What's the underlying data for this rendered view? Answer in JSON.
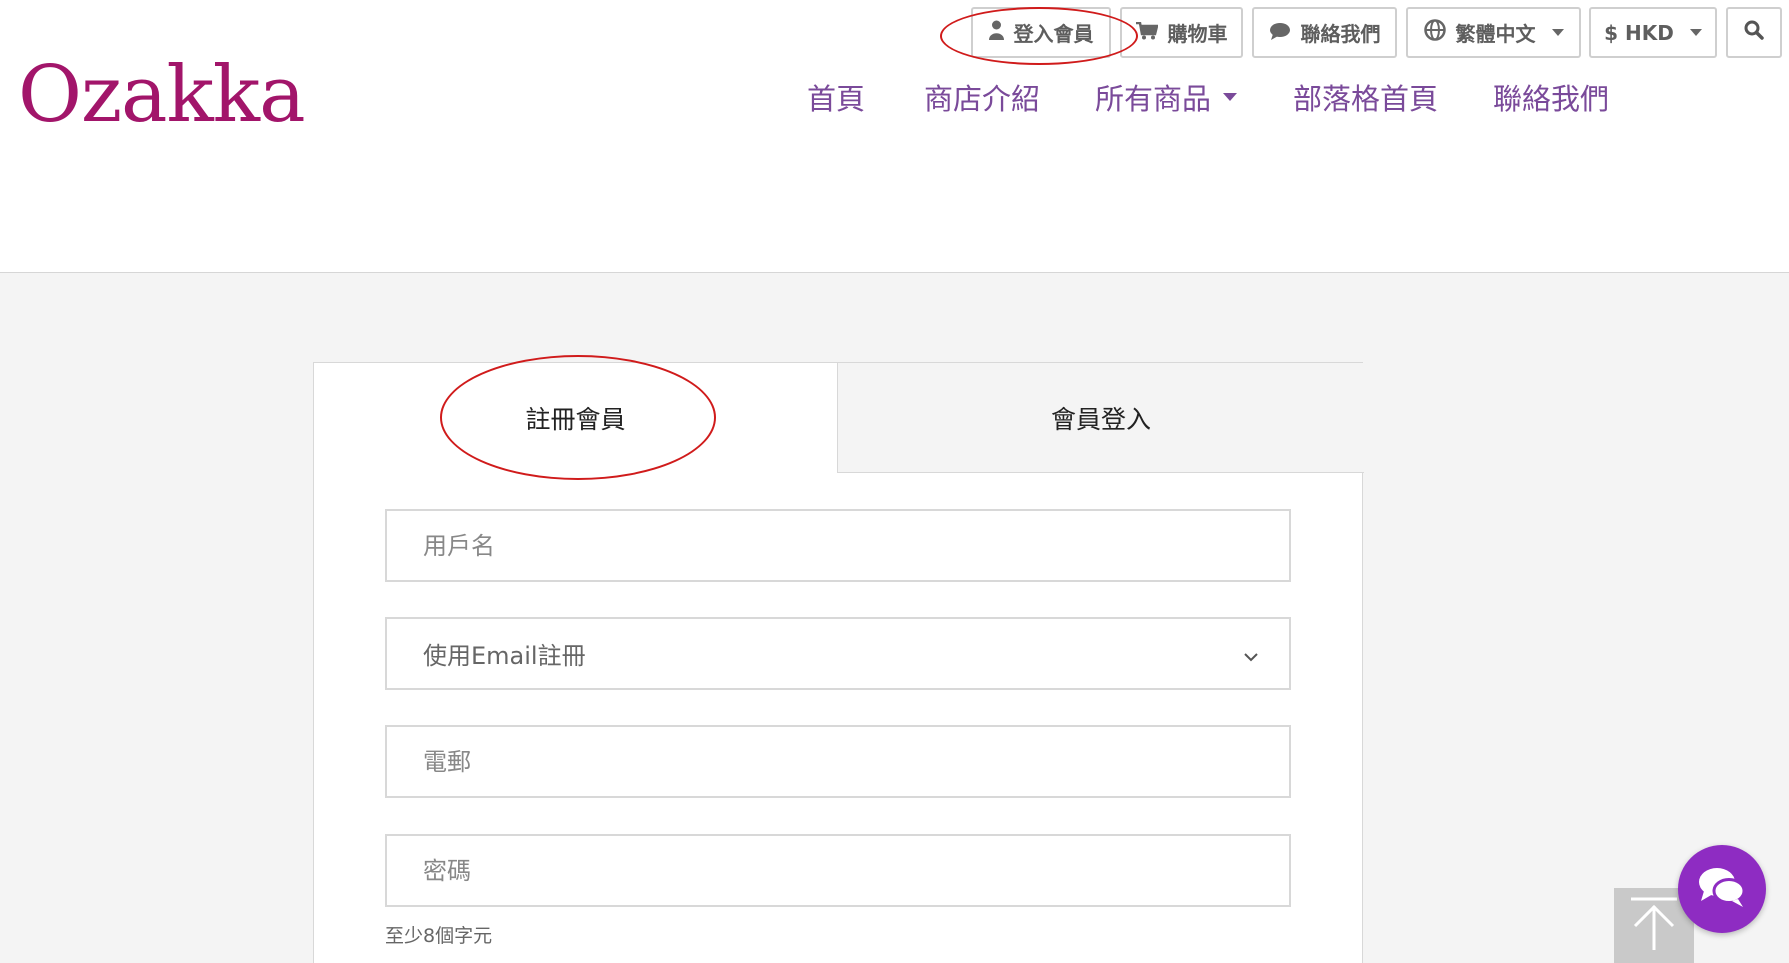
{
  "brand": {
    "logo_text": "Ozakka",
    "logo_color": "#a2156a"
  },
  "topbar": {
    "login_label": "登入會員",
    "cart_label": "購物車",
    "contact_label": "聯絡我們",
    "language_label": "繁體中文",
    "currency_label": "$ HKD",
    "icons": [
      "user-icon",
      "cart-icon",
      "chat-bubble-icon",
      "globe-icon",
      "search-icon"
    ]
  },
  "nav": {
    "items": [
      {
        "label": "首頁"
      },
      {
        "label": "商店介紹"
      },
      {
        "label": "所有商品",
        "has_dropdown": true
      },
      {
        "label": "部落格首頁"
      },
      {
        "label": "聯絡我們"
      }
    ],
    "color": "#7a4a9a"
  },
  "form": {
    "tabs": [
      {
        "label": "註冊會員",
        "active": true
      },
      {
        "label": "會員登入",
        "active": false
      }
    ],
    "username_placeholder": "用戶名",
    "register_method_value": "使用Email註冊",
    "email_placeholder": "電郵",
    "password_placeholder": "密碼",
    "password_hint": "至少8個字元"
  },
  "colors": {
    "annotation": "#d01b1b",
    "chat_button": "#8e2cc2",
    "back_to_top": "#c9c9c9"
  }
}
